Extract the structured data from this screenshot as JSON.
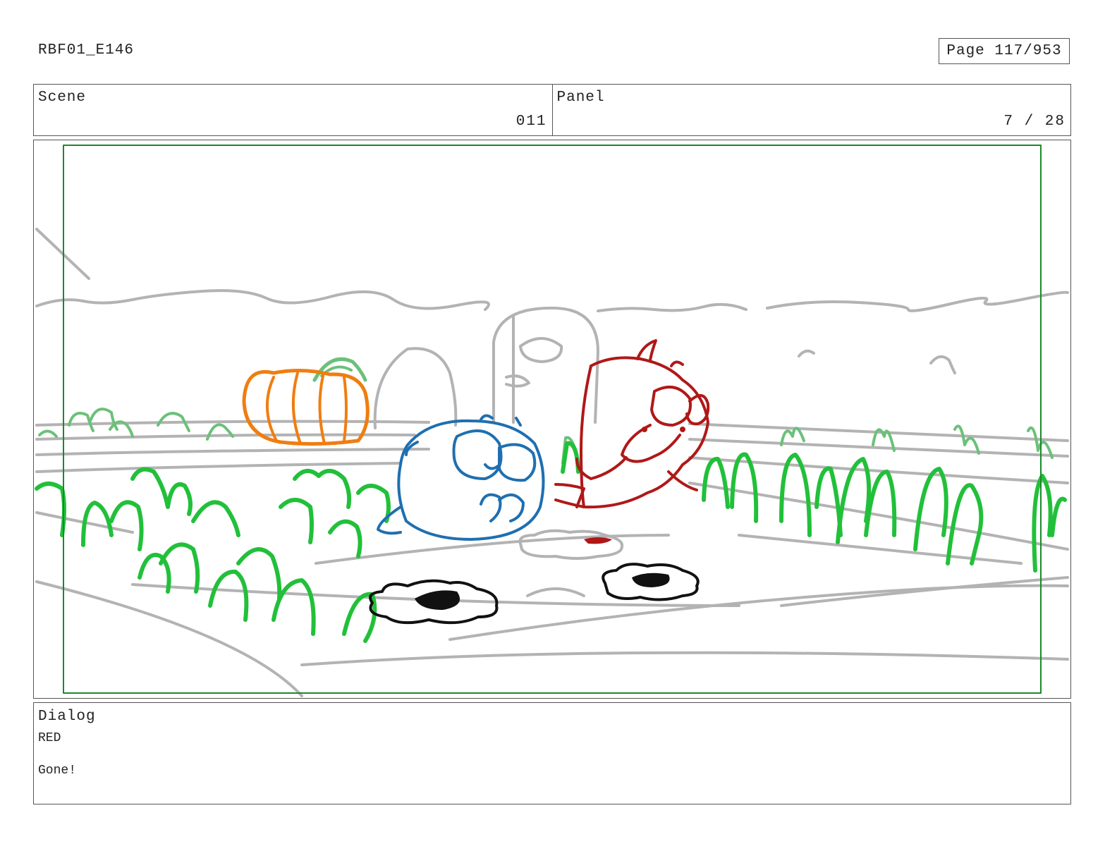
{
  "header": {
    "project_id": "RBF01_E146",
    "page_label": "Page 117/953"
  },
  "info": {
    "scene_label": "Scene",
    "scene_value": "011",
    "panel_label": "Panel",
    "panel_value": "7 / 28"
  },
  "panel": {
    "colors": {
      "background_lines": "#b3b3b3",
      "plants": "#22c03a",
      "distant_plants": "#6cc07a",
      "pumpkin": "#f07d10",
      "blue_character": "#1f6fb0",
      "red_character": "#b01818",
      "holes": "#111111",
      "safe_frame": "#1a8a2a"
    }
  },
  "dialog": {
    "label": "Dialog",
    "speaker": "RED",
    "line": "Gone!"
  }
}
